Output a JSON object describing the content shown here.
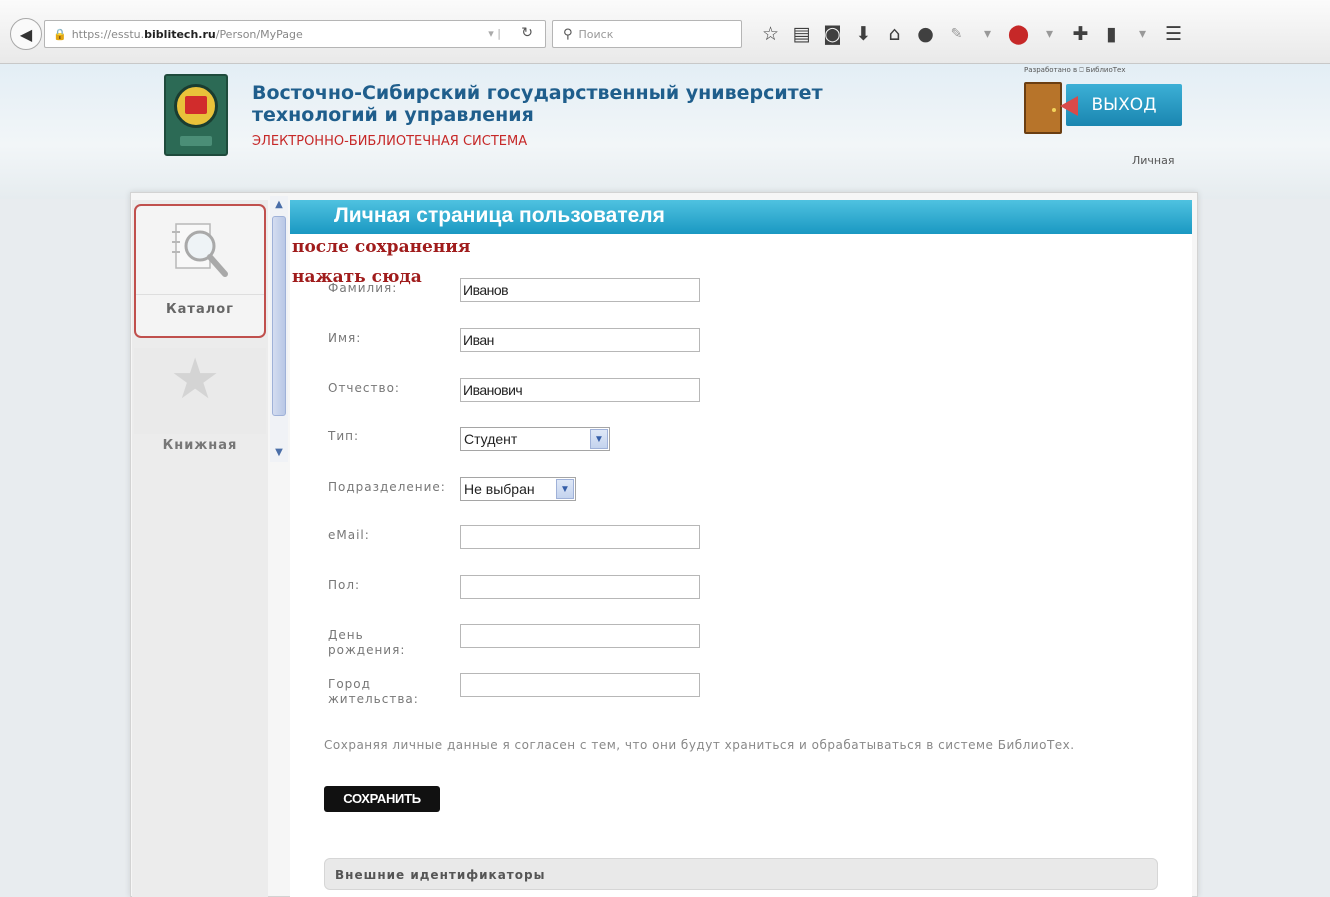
{
  "browser": {
    "url_prefix": "https://esstu.",
    "url_host": "biblitech.ru",
    "url_path": "/Person/MyPage",
    "search_placeholder": "Поиск"
  },
  "header": {
    "university_name": "Восточно-Сибирский государственный университет технологий и управления",
    "system_name": "ЭЛЕКТРОННО-БИБЛИОТЕЧНАЯ СИСТЕМА",
    "developer_credit": "Разработано в ⎕ БиблиоТех",
    "exit_label": "ВЫХОД",
    "personal_link": "Личная"
  },
  "sidebar": {
    "catalog_label": "Каталог",
    "book_label": "Книжная"
  },
  "page": {
    "title": "Личная страница пользователя",
    "note_line1": "после сохранения",
    "note_line2": "нажать сюда"
  },
  "form": {
    "surname_label": "Фамилия:",
    "surname_value": "Иванов",
    "name_label": "Имя:",
    "name_value": "Иван",
    "patronymic_label": "Отчество:",
    "patronymic_value": "Иванович",
    "type_label": "Тип:",
    "type_value": "Студент",
    "department_label": "Подразделение:",
    "department_value": "Не выбран",
    "email_label": "eMail:",
    "email_value": "",
    "gender_label": "Пол:",
    "gender_value": "",
    "birthday_label_1": "День",
    "birthday_label_2": "рождения:",
    "birthday_value": "",
    "city_label_1": "Город",
    "city_label_2": "жительства:",
    "city_value": "",
    "consent_text": "Сохраняя личные данные я согласен с тем, что они будут храниться и обрабатываться в системе БиблиоТех.",
    "save_label": "СОХРАНИТЬ"
  },
  "external_ids": {
    "title": "Внешние идентификаторы"
  },
  "colors": {
    "title_bar": "#1a98c2",
    "note": "#a01c1c",
    "header_text": "#1f5e8c",
    "ebs_text": "#c62828",
    "selected_card_border": "#c0504d"
  }
}
